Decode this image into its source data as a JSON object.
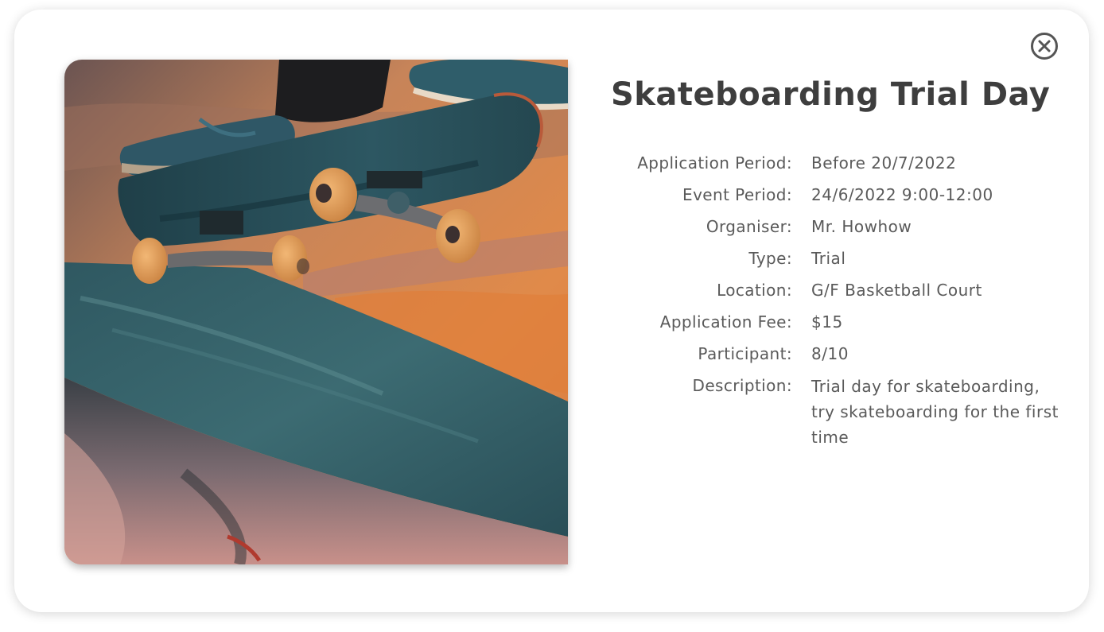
{
  "event": {
    "title": "Skateboarding Trial Day",
    "image_alt": "Skateboarder grinding on a ledge at sunset",
    "details": [
      {
        "label": "Application Period:",
        "value": "Before 20/7/2022"
      },
      {
        "label": "Event Period:",
        "value": "24/6/2022 9:00-12:00"
      },
      {
        "label": "Organiser:",
        "value": "Mr. Howhow"
      },
      {
        "label": "Type:",
        "value": "Trial"
      },
      {
        "label": "Location:",
        "value": "G/F Basketball Court"
      },
      {
        "label": "Application Fee:",
        "value": "$15"
      },
      {
        "label": "Participant:",
        "value": "8/10"
      },
      {
        "label": "Description:",
        "value": "Trial day for skateboarding, try skateboarding for the first time"
      }
    ]
  },
  "icons": {
    "close": "close-circle-icon"
  },
  "colors": {
    "title": "#3e3e3e",
    "text": "#5a5a5a",
    "close_icon": "#555555",
    "background": "#ffffff"
  }
}
